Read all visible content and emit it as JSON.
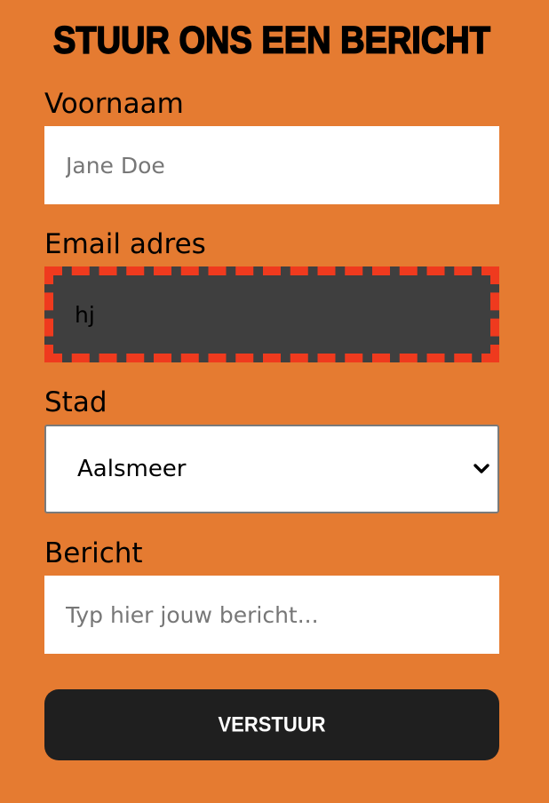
{
  "form": {
    "title": "Stuur ons een bericht",
    "fields": {
      "voornaam": {
        "label": "Voornaam",
        "placeholder": "Jane Doe",
        "value": ""
      },
      "email": {
        "label": "Email adres",
        "placeholder": "",
        "value": "hj"
      },
      "stad": {
        "label": "Stad",
        "selected": "Aalsmeer"
      },
      "bericht": {
        "label": "Bericht",
        "placeholder": "Typ hier jouw bericht...",
        "value": ""
      }
    },
    "submit_label": "Verstuur"
  },
  "icons": {
    "select_arrow": "chevron-down-icon"
  },
  "colors": {
    "background": "#e57b31",
    "input_background": "#ffffff",
    "invalid_input_background": "#3f3f3f",
    "invalid_border": "#ef3a1e",
    "button_background": "#1f1f1f",
    "button_text": "#ffffff",
    "placeholder_text": "#777777"
  }
}
